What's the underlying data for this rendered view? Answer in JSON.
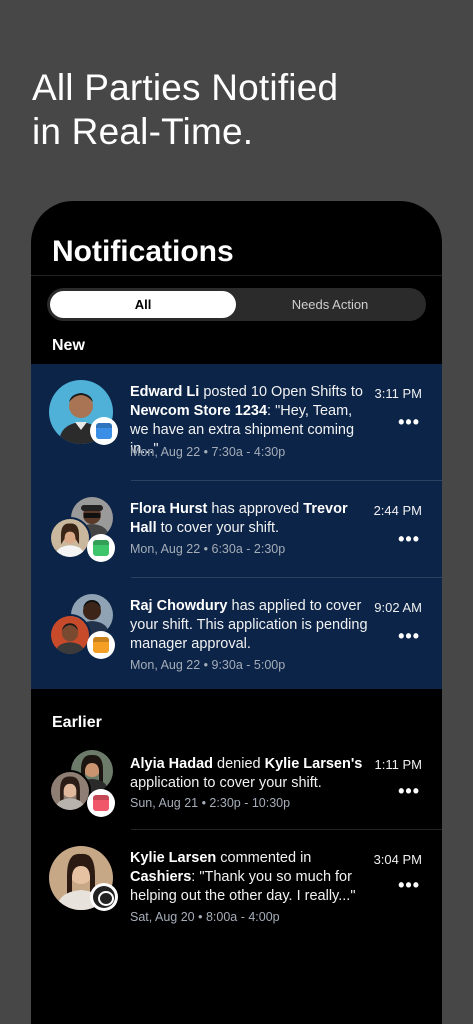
{
  "headline": {
    "line1": "All Parties Notified",
    "line2": "in Real-Time."
  },
  "screen": {
    "title": "Notifications",
    "tabs": [
      {
        "label": "All",
        "active": true
      },
      {
        "label": "Needs Action",
        "active": false
      }
    ],
    "sections": {
      "new_label": "New",
      "earlier_label": "Earlier"
    }
  },
  "notifications": [
    {
      "actor": "Edward Li",
      "text1": " posted 10 Open Shifts to ",
      "target": "Newcom Store 1234",
      "text2": ": \"Hey, Team, we have an extra shipment coming in...\"",
      "time": "3:11 PM",
      "meta": "Mon, Aug 22 • 7:30a - 4:30p",
      "badge_color": "#3a8ee6",
      "badge_icon": "calendar-icon"
    },
    {
      "actor": "Flora Hurst",
      "text1": " has approved ",
      "target": "Trevor Hall",
      "text2": " to cover your shift.",
      "time": "2:44 PM",
      "meta": "Mon, Aug 22 • 6:30a - 2:30p",
      "badge_color": "#3ec46a",
      "badge_icon": "calendar-icon"
    },
    {
      "actor": "Raj Chowdury",
      "text1": " has applied to cover your shift. This application is pending manager approval.",
      "target": "",
      "text2": "",
      "time": "9:02 AM",
      "meta": "Mon, Aug 22 • 9:30a - 5:00p",
      "badge_color": "#f5a025",
      "badge_icon": "calendar-icon"
    },
    {
      "actor": "Alyia Hadad",
      "text1": " denied ",
      "target": "Kylie Larsen's",
      "text2": " application to cover your shift.",
      "time": "1:11 PM",
      "meta": "Sun, Aug 21 • 2:30p - 10:30p",
      "badge_color": "#f0586a",
      "badge_icon": "calendar-icon"
    },
    {
      "actor": "Kylie Larsen",
      "text1": " commented in ",
      "target": "Cashiers",
      "text2": ": \"Thank you so much for helping out the other day. I really...\"",
      "time": "3:04 PM",
      "meta": "Sat, Aug 20 • 8:00a - 4:00p",
      "badge_color": "#222222",
      "badge_icon": "chat-bubble-icon"
    }
  ],
  "more_glyph": "•••",
  "colors": {
    "page_bg": "#474747",
    "phone_bg": "#000000",
    "new_highlight": "#0b2448",
    "tab_active_bg": "#ffffff"
  }
}
